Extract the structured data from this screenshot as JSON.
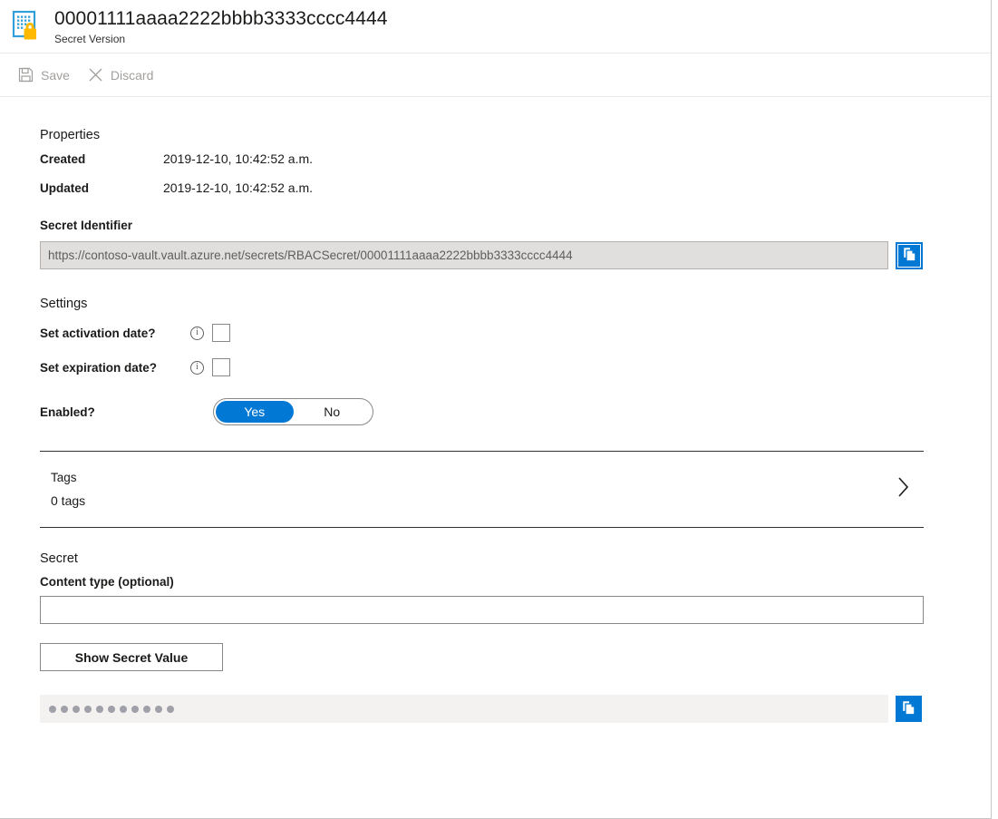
{
  "header": {
    "title": "00001111aaaa2222bbbb3333cccc4444",
    "subtitle": "Secret Version",
    "icon": "secret-version-icon"
  },
  "commandbar": {
    "save_label": "Save",
    "save_icon": "save-floppy-icon",
    "discard_label": "Discard",
    "discard_icon": "close-x-icon"
  },
  "properties": {
    "heading": "Properties",
    "created_label": "Created",
    "created_value": "2019-12-10, 10:42:52 a.m.",
    "updated_label": "Updated",
    "updated_value": "2019-12-10, 10:42:52 a.m.",
    "identifier_label": "Secret Identifier",
    "identifier_value": "https://contoso-vault.vault.azure.net/secrets/RBACSecret/00001111aaaa2222bbbb3333cccc4444",
    "copy_icon": "copy-icon"
  },
  "settings": {
    "heading": "Settings",
    "activation_label": "Set activation date?",
    "activation_info_icon": "info-icon",
    "activation_checked": "false",
    "expiration_label": "Set expiration date?",
    "expiration_info_icon": "info-icon",
    "expiration_checked": "false",
    "enabled_label": "Enabled?",
    "enabled_yes": "Yes",
    "enabled_no": "No",
    "enabled_selected": "Yes"
  },
  "tags": {
    "title": "Tags",
    "count_text": "0 tags",
    "chevron_icon": "chevron-right-icon"
  },
  "secret": {
    "heading": "Secret",
    "content_type_label": "Content type (optional)",
    "content_type_value": "",
    "content_type_placeholder": "",
    "show_button_label": "Show Secret Value",
    "masked_value_dots": 11,
    "copy_icon": "copy-icon"
  },
  "colors": {
    "accent": "#0078d4",
    "icon_blue": "#2e9bd6",
    "lock_yellow": "#ffb900",
    "disabled_text": "#a19f9d",
    "readonly_bg": "#e1dfdd",
    "masked_bg": "#f3f2f1"
  }
}
